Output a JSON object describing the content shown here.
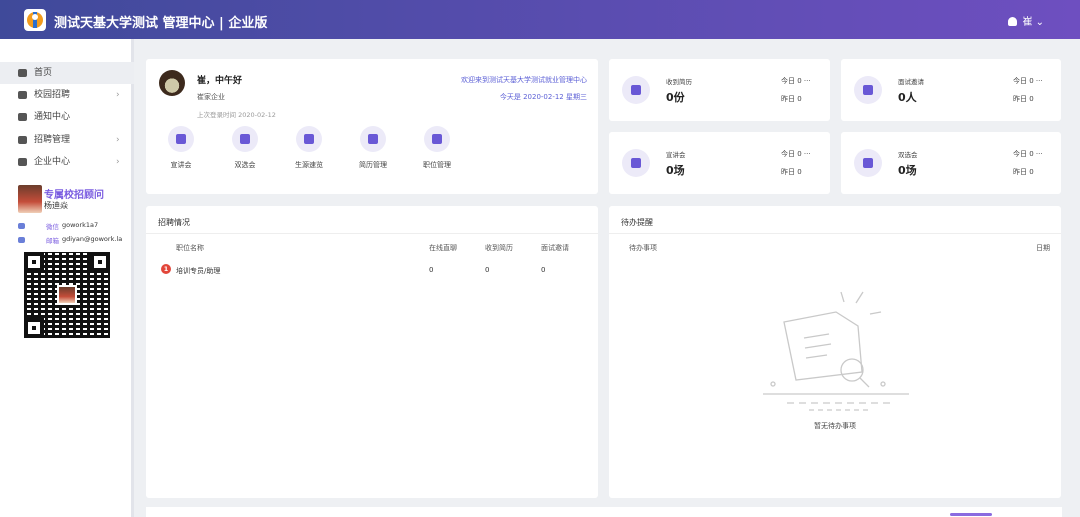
{
  "header": {
    "app_title": "测试天基大学测试 管理中心 | 企业版",
    "user_menu": "崔"
  },
  "sidebar": {
    "items": [
      {
        "label": "首页",
        "active": true,
        "has_arrow": false,
        "icon": "home-icon"
      },
      {
        "label": "校园招聘",
        "active": false,
        "has_arrow": true,
        "icon": "graduation-cap-icon"
      },
      {
        "label": "通知中心",
        "active": false,
        "has_arrow": false,
        "icon": "chat-bubble-icon"
      },
      {
        "label": "招聘管理",
        "active": false,
        "has_arrow": true,
        "icon": "user-tie-icon"
      },
      {
        "label": "企业中心",
        "active": false,
        "has_arrow": true,
        "icon": "building-icon"
      }
    ],
    "arrow_glyph": "›",
    "advisor": {
      "title": "专属校招顾问",
      "name": "杨迪焱",
      "contacts": [
        {
          "icon": "wechat-icon",
          "label": "微信",
          "value": "gowork1a7"
        },
        {
          "icon": "mail-icon",
          "label": "邮箱",
          "value": "gdiyan@gowork.la"
        }
      ]
    }
  },
  "profile_card": {
    "name": "崔，中午好",
    "company": "崔家企业",
    "last_login": "上次登录时间 2020-02-12",
    "welcome": "欢迎来到测试天基大学测试就业管理中心",
    "today": "今天是 2020-02-12   星期三",
    "quick_links": [
      "宣讲会",
      "双选会",
      "生源速览",
      "简历管理",
      "职位管理"
    ]
  },
  "stats": [
    {
      "label": "收到简历",
      "value": "0份",
      "today": "今日 0 ···",
      "yesterday": "昨日 0",
      "icon": "book-icon"
    },
    {
      "label": "面试邀请",
      "value": "0人",
      "today": "今日 0 ···",
      "yesterday": "昨日 0",
      "icon": "mail-open-icon"
    },
    {
      "label": "宣讲会",
      "value": "0场",
      "today": "今日 0 ···",
      "yesterday": "昨日 0",
      "icon": "microphone-icon"
    },
    {
      "label": "双选会",
      "value": "0场",
      "today": "今日 0 ···",
      "yesterday": "昨日 0",
      "icon": "flag-icon"
    }
  ],
  "recruit": {
    "title": "招聘情况",
    "columns": [
      "职位名称",
      "在线直聊",
      "收到简历",
      "面试邀请"
    ],
    "rows": [
      {
        "badge": "1",
        "name": "培训专员/助理",
        "chat": "0",
        "resumes": "0",
        "interviews": "0"
      }
    ]
  },
  "todo": {
    "title": "待办提醒",
    "col_item": "待办事项",
    "col_date": "日期",
    "empty_text": "暂无待办事项"
  },
  "colors": {
    "header_start": "#3f4a9a",
    "header_end": "#6e4fc0",
    "accent": "#6958d6",
    "badge": "#e2463a"
  }
}
